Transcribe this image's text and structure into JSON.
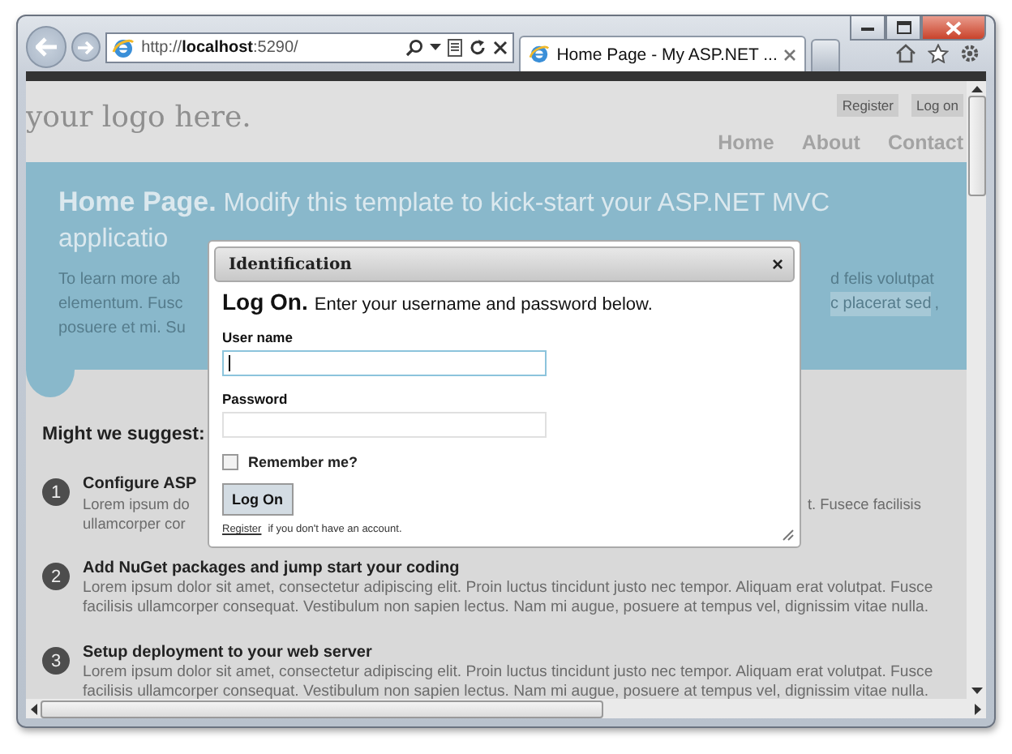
{
  "browser": {
    "address": "http://**localhost**:5290/",
    "tabs": [
      {
        "title": "Home Page - My ASP.NET ...",
        "selected": true
      }
    ]
  },
  "site": {
    "logo": "your logo here.",
    "header_links": [
      "Register",
      "Log on"
    ],
    "nav": [
      "Home",
      "About",
      "Contact"
    ]
  },
  "hero": {
    "title_bold": "Home Page.",
    "title_rest": "Modify this template to kick-start your ASP.NET MVC",
    "title_line2": "applicatio",
    "left_lines": [
      "To learn more ab",
      "elementum. Fusc",
      "posuere et mi. Su"
    ],
    "right_lines": [
      {
        "text": "d felis volutpat",
        "highlighted": false
      },
      {
        "text": "c placerat sed",
        "highlighted": true,
        "after": ","
      }
    ]
  },
  "suggest_heading": "Might we suggest:",
  "items": [
    {
      "kind": "covered",
      "number": "1",
      "title": "Configure ASP",
      "left_lines": [
        "Lorem ipsum do",
        "ullamcorper cor"
      ],
      "right_lines": [
        "t. Fusece facilisis"
      ]
    },
    {
      "kind": "full",
      "number": "2",
      "title": "Add NuGet packages and jump start your coding",
      "body": "Lorem ipsum dolor sit amet, consectetur adipiscing elit. Proin luctus tincidunt justo nec tempor. Aliquam erat volutpat. Fusce facilisis ullamcorper consequat. Vestibulum non sapien lectus. Nam mi augue, posuere at tempus vel, dignissim vitae nulla."
    },
    {
      "kind": "full",
      "number": "3",
      "title": "Setup deployment to your web server",
      "body": "Lorem ipsum dolor sit amet, consectetur adipiscing elit. Proin luctus tincidunt justo nec tempor. Aliquam erat volutpat. Fusce facilisis ullamcorper consequat. Vestibulum non sapien lectus. Nam mi augue, posuere at tempus vel, dignissim vitae nulla."
    }
  ],
  "dialog": {
    "title": "Identification",
    "close": "×",
    "heading": "Log On.",
    "instruction": "Enter your username and password below.",
    "fields": [
      {
        "label": "User name",
        "focused": true
      },
      {
        "label": "Password",
        "focused": false
      }
    ],
    "remember": {
      "label": "Remember me?",
      "checked": false
    },
    "submit": "Log On",
    "register_link": "Register",
    "register_text": "if you don't have an account."
  }
}
